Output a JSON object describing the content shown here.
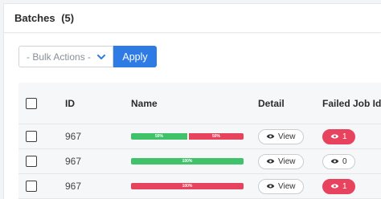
{
  "header": {
    "title": "Batches",
    "count": "(5)"
  },
  "toolbar": {
    "bulk_placeholder": "- Bulk Actions -",
    "apply_label": "Apply"
  },
  "table": {
    "columns": {
      "id": "ID",
      "name": "Name",
      "detail": "Detail",
      "failed": "Failed Job Ids"
    },
    "rows": [
      {
        "id": "967",
        "progress": [
          {
            "label": "50%",
            "value": 50,
            "status": "success"
          },
          {
            "label": "50%",
            "value": 50,
            "status": "failed"
          }
        ],
        "detail": "View",
        "failed": "1",
        "failed_style": "red"
      },
      {
        "id": "967",
        "progress": [
          {
            "label": "100%",
            "value": 100,
            "status": "success"
          }
        ],
        "detail": "View",
        "failed": "0",
        "failed_style": "zero"
      },
      {
        "id": "967",
        "progress": [
          {
            "label": "100%",
            "value": 100,
            "status": "failed"
          }
        ],
        "detail": "View",
        "failed": "1",
        "failed_style": "red"
      }
    ]
  },
  "colors": {
    "accent": "#2f7be5",
    "success": "#3fc26a",
    "failed": "#e8435e"
  },
  "icons": {
    "dropdown": "chevron-down-icon",
    "detail": "eye-icon",
    "checkbox": "checkbox"
  }
}
